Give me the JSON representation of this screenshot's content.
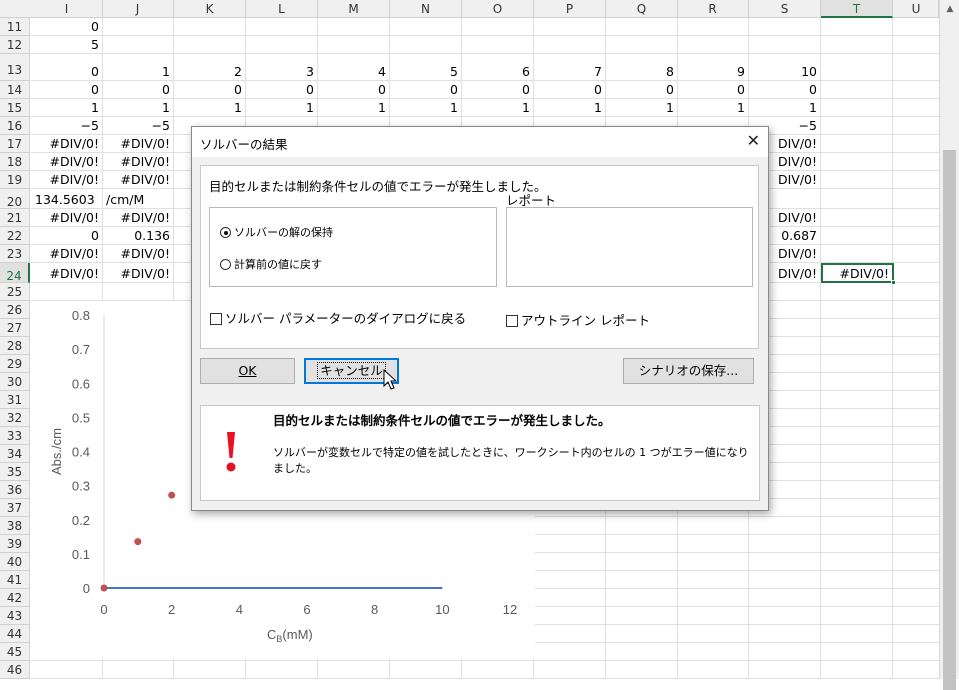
{
  "columns": [
    "I",
    "J",
    "K",
    "L",
    "M",
    "N",
    "O",
    "P",
    "Q",
    "R",
    "S",
    "T",
    "U"
  ],
  "selected_column": "T",
  "rows": [
    "11",
    "12",
    "13",
    "14",
    "15",
    "16",
    "17",
    "18",
    "19",
    "20",
    "21",
    "22",
    "23",
    "24",
    "25",
    "26",
    "27",
    "28",
    "29",
    "30",
    "31",
    "32",
    "33",
    "34",
    "35",
    "36",
    "37",
    "38",
    "39",
    "40",
    "41",
    "42",
    "43",
    "44",
    "45",
    "46"
  ],
  "selected_row": "24",
  "cells": [
    {
      "row": "11",
      "col": "I",
      "v": "0"
    },
    {
      "row": "12",
      "col": "I",
      "v": "5"
    },
    {
      "row": "13",
      "col": "I",
      "v": "0"
    },
    {
      "row": "13",
      "col": "J",
      "v": "1"
    },
    {
      "row": "13",
      "col": "K",
      "v": "2"
    },
    {
      "row": "13",
      "col": "L",
      "v": "3"
    },
    {
      "row": "13",
      "col": "M",
      "v": "4"
    },
    {
      "row": "13",
      "col": "N",
      "v": "5"
    },
    {
      "row": "13",
      "col": "O",
      "v": "6"
    },
    {
      "row": "13",
      "col": "P",
      "v": "7"
    },
    {
      "row": "13",
      "col": "Q",
      "v": "8"
    },
    {
      "row": "13",
      "col": "R",
      "v": "9"
    },
    {
      "row": "13",
      "col": "S",
      "v": "10"
    },
    {
      "row": "14",
      "col": "I",
      "v": "0"
    },
    {
      "row": "14",
      "col": "J",
      "v": "0"
    },
    {
      "row": "14",
      "col": "K",
      "v": "0"
    },
    {
      "row": "14",
      "col": "L",
      "v": "0"
    },
    {
      "row": "14",
      "col": "M",
      "v": "0"
    },
    {
      "row": "14",
      "col": "N",
      "v": "0"
    },
    {
      "row": "14",
      "col": "O",
      "v": "0"
    },
    {
      "row": "14",
      "col": "P",
      "v": "0"
    },
    {
      "row": "14",
      "col": "Q",
      "v": "0"
    },
    {
      "row": "14",
      "col": "R",
      "v": "0"
    },
    {
      "row": "14",
      "col": "S",
      "v": "0"
    },
    {
      "row": "15",
      "col": "I",
      "v": "1"
    },
    {
      "row": "15",
      "col": "J",
      "v": "1"
    },
    {
      "row": "15",
      "col": "K",
      "v": "1"
    },
    {
      "row": "15",
      "col": "L",
      "v": "1"
    },
    {
      "row": "15",
      "col": "M",
      "v": "1"
    },
    {
      "row": "15",
      "col": "N",
      "v": "1"
    },
    {
      "row": "15",
      "col": "O",
      "v": "1"
    },
    {
      "row": "15",
      "col": "P",
      "v": "1"
    },
    {
      "row": "15",
      "col": "Q",
      "v": "1"
    },
    {
      "row": "15",
      "col": "R",
      "v": "1"
    },
    {
      "row": "15",
      "col": "S",
      "v": "1"
    },
    {
      "row": "16",
      "col": "I",
      "v": "−5"
    },
    {
      "row": "16",
      "col": "J",
      "v": "−5"
    },
    {
      "row": "16",
      "col": "S",
      "v": "−5"
    },
    {
      "row": "17",
      "col": "I",
      "v": "#DIV/0!"
    },
    {
      "row": "17",
      "col": "J",
      "v": "#DIV/0!"
    },
    {
      "row": "17",
      "col": "S",
      "v": "DIV/0!"
    },
    {
      "row": "18",
      "col": "I",
      "v": "#DIV/0!"
    },
    {
      "row": "18",
      "col": "J",
      "v": "#DIV/0!"
    },
    {
      "row": "18",
      "col": "S",
      "v": "DIV/0!"
    },
    {
      "row": "19",
      "col": "I",
      "v": "#DIV/0!"
    },
    {
      "row": "19",
      "col": "J",
      "v": "#DIV/0!"
    },
    {
      "row": "19",
      "col": "S",
      "v": "DIV/0!"
    },
    {
      "row": "20",
      "col": "I",
      "v": "134.5603",
      "align": "left"
    },
    {
      "row": "20",
      "col": "J",
      "v": "/cm/M",
      "align": "left"
    },
    {
      "row": "21",
      "col": "I",
      "v": "#DIV/0!"
    },
    {
      "row": "21",
      "col": "J",
      "v": "#DIV/0!"
    },
    {
      "row": "21",
      "col": "S",
      "v": "DIV/0!"
    },
    {
      "row": "22",
      "col": "I",
      "v": "0"
    },
    {
      "row": "22",
      "col": "J",
      "v": "0.136"
    },
    {
      "row": "22",
      "col": "S",
      "v": "0.687"
    },
    {
      "row": "23",
      "col": "I",
      "v": "#DIV/0!"
    },
    {
      "row": "23",
      "col": "J",
      "v": "#DIV/0!"
    },
    {
      "row": "23",
      "col": "S",
      "v": "DIV/0!"
    },
    {
      "row": "24",
      "col": "I",
      "v": "#DIV/0!"
    },
    {
      "row": "24",
      "col": "J",
      "v": "#DIV/0!"
    },
    {
      "row": "24",
      "col": "S",
      "v": "DIV/0!"
    },
    {
      "row": "24",
      "col": "T",
      "v": "#DIV/0!"
    }
  ],
  "chart": {
    "y_ticks": [
      "0.8",
      "0.7",
      "0.6",
      "0.5",
      "0.4",
      "0.3",
      "0.2",
      "0.1",
      "0"
    ],
    "x_ticks": [
      "0",
      "2",
      "4",
      "6",
      "8",
      "10",
      "12"
    ],
    "ylabel": "Abs./cm",
    "xlabel_main": "C",
    "xlabel_sub": "B",
    "xlabel_unit": "(mM)",
    "points": [
      {
        "x": 0,
        "y": 0
      },
      {
        "x": 1,
        "y": 0.136
      },
      {
        "x": 2,
        "y": 0.272
      }
    ],
    "line": [
      {
        "x": 0,
        "y": 0
      },
      {
        "x": 10,
        "y": 0
      }
    ],
    "point_color": "#c0504d",
    "line_color": "#4472c4"
  },
  "dialog": {
    "title": "ソルバーの結果",
    "close": "✕",
    "status_message": "目的セルまたは制約条件セルの値でエラーが発生しました。",
    "report_label": "レポート",
    "radio_keep": "ソルバーの解の保持",
    "radio_restore": "計算前の値に戻す",
    "check_return": "ソルバー パラメーターのダイアログに戻る",
    "check_outline": "アウトライン レポート",
    "ok_label": "OK",
    "cancel_label": "キャンセル",
    "save_scenario_label": "シナリオの保存...",
    "msg_title": "目的セルまたは制約条件セルの値でエラーが発生しました。",
    "msg_body": "ソルバーが変数セルで特定の値を試したときに、ワークシート内のセルの 1 つがエラー値になりました。",
    "warning_color": "#e81123"
  }
}
